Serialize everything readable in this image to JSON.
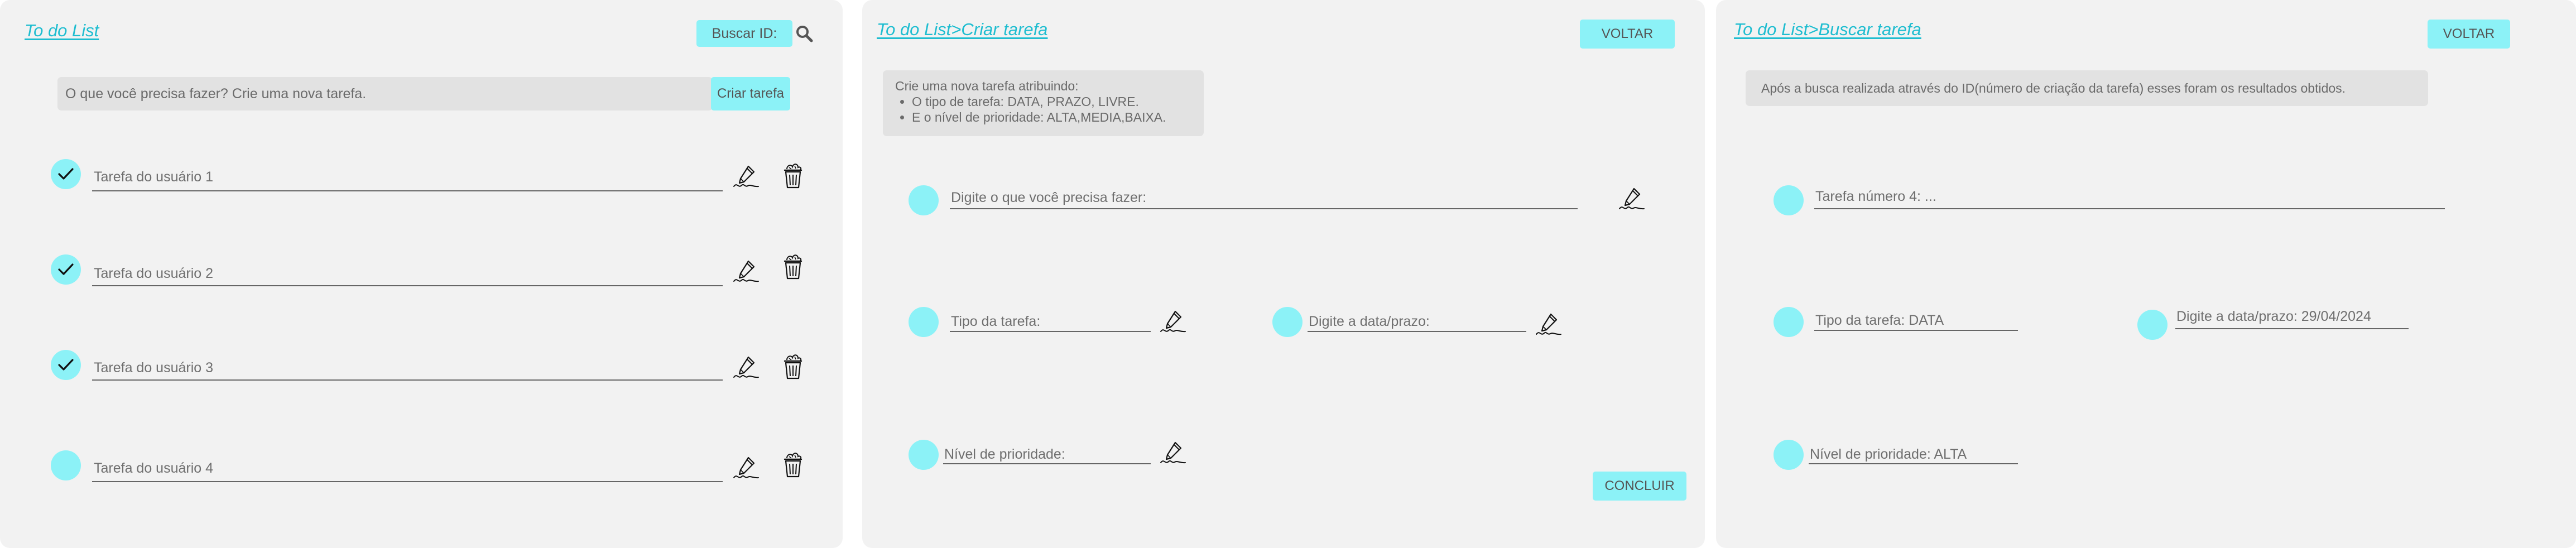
{
  "colors": {
    "accent": "#1ebdd0",
    "button_bg": "#8cf2f7",
    "panel_bg": "#f2f2f2",
    "box_bg": "#e2e2e2",
    "text": "#555555"
  },
  "list_screen": {
    "title": "To do List",
    "search_label": "Buscar ID:",
    "search_icon": "search-icon",
    "new_task_placeholder": "O que você precisa fazer? Crie uma nova tarefa.",
    "create_button": "Criar tarefa",
    "tasks": [
      {
        "label": "Tarefa do usuário 1",
        "done": true
      },
      {
        "label": "Tarefa do usuário 2",
        "done": true
      },
      {
        "label": "Tarefa do usuário 3",
        "done": true
      },
      {
        "label": "Tarefa do usuário 4",
        "done": false
      }
    ],
    "edit_icon": "pencil-signature-icon",
    "delete_icon": "trash-icon"
  },
  "create_screen": {
    "breadcrumb": "To do List>Criar tarefa",
    "back_button": "VOLTAR",
    "info_title": "Crie uma nova tarefa atribuindo:",
    "info_items": [
      "O tipo de tarefa: DATA, PRAZO, LIVRE.",
      "E o nível de prioridade: ALTA,MEDIA,BAIXA."
    ],
    "task_field": "Digite o que você precisa fazer:",
    "type_field": "Tipo da tarefa:",
    "date_field": "Digite a data/prazo:",
    "priority_field": "Nível de prioridade:",
    "conclude_button": "CONCLUIR"
  },
  "search_screen": {
    "breadcrumb": "To do List>Buscar tarefa",
    "back_button": "VOLTAR",
    "info_text": "Após a busca realizada através do ID(número de criação da tarefa) esses foram os resultados obtidos.",
    "task_field": "Tarefa número 4: ...",
    "type_field": "Tipo da tarefa: DATA",
    "date_field": "Digite a data/prazo: 29/04/2024",
    "priority_field": "Nível de prioridade: ALTA"
  }
}
